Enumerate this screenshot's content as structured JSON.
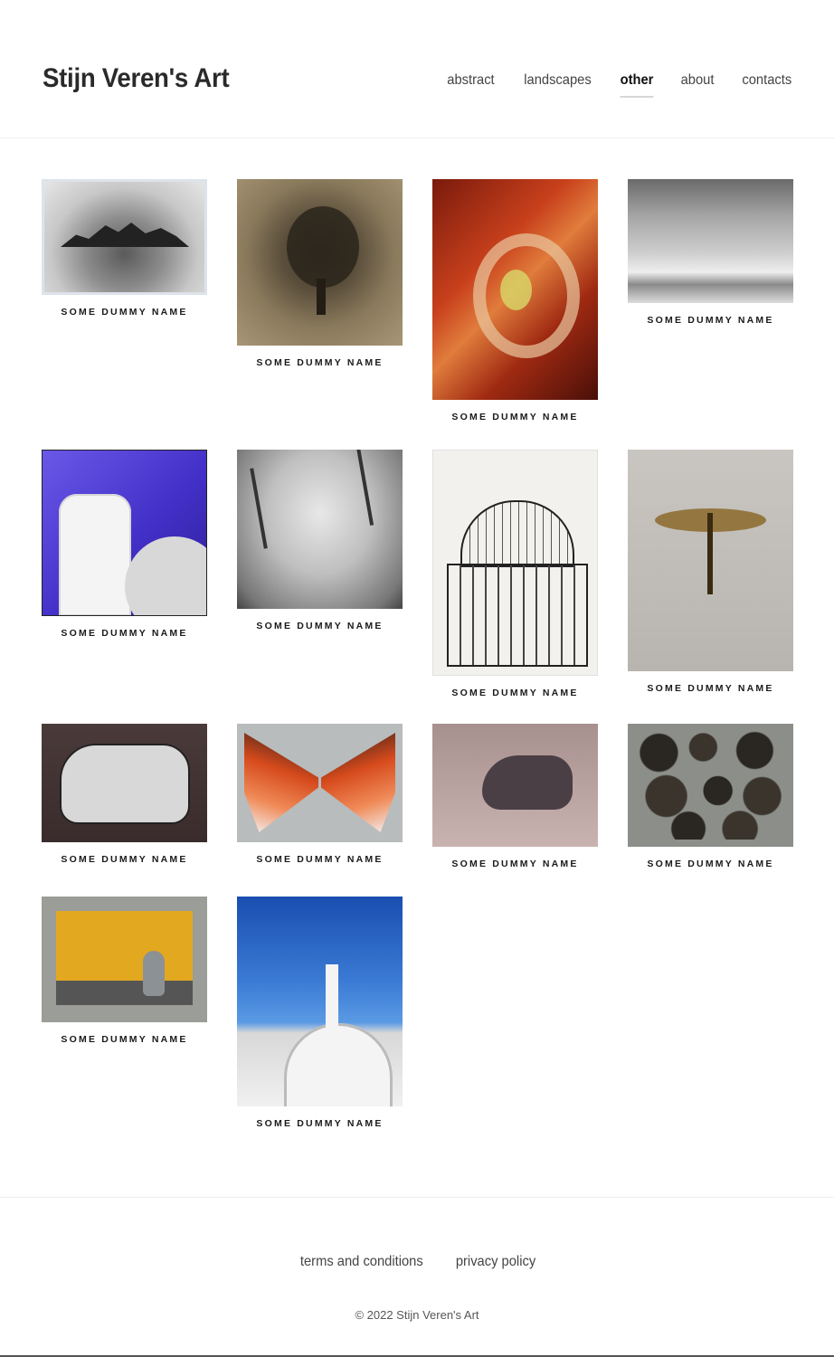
{
  "site": {
    "title": "Stijn Veren's Art"
  },
  "nav": {
    "items": [
      {
        "label": "abstract",
        "active": false
      },
      {
        "label": "landscapes",
        "active": false
      },
      {
        "label": "other",
        "active": true
      },
      {
        "label": "about",
        "active": false
      },
      {
        "label": "contacts",
        "active": false
      }
    ]
  },
  "gallery": {
    "items": [
      {
        "caption": "Some Dummy Name",
        "subject": "mountain-range-charcoal"
      },
      {
        "caption": "Some Dummy Name",
        "subject": "tree-sepia"
      },
      {
        "caption": "Some Dummy Name",
        "subject": "abstract-red-swan"
      },
      {
        "caption": "Some Dummy Name",
        "subject": "stormy-sky-charcoal"
      },
      {
        "caption": "Some Dummy Name",
        "subject": "church-bell-tower-blue"
      },
      {
        "caption": "Some Dummy Name",
        "subject": "winter-trees-charcoal"
      },
      {
        "caption": "Some Dummy Name",
        "subject": "dome-cathedral-ink"
      },
      {
        "caption": "Some Dummy Name",
        "subject": "dragonfly"
      },
      {
        "caption": "Some Dummy Name",
        "subject": "rhino-white"
      },
      {
        "caption": "Some Dummy Name",
        "subject": "butterfly-orange"
      },
      {
        "caption": "Some Dummy Name",
        "subject": "rhino-dark"
      },
      {
        "caption": "Some Dummy Name",
        "subject": "stones-pattern"
      },
      {
        "caption": "Some Dummy Name",
        "subject": "vase-flowers-yellow"
      },
      {
        "caption": "Some Dummy Name",
        "subject": "church-cross-blue-sky"
      }
    ]
  },
  "footer": {
    "links": [
      {
        "label": "terms and conditions"
      },
      {
        "label": "privacy policy"
      }
    ],
    "copyright": "© 2022 Stijn Veren's Art"
  }
}
